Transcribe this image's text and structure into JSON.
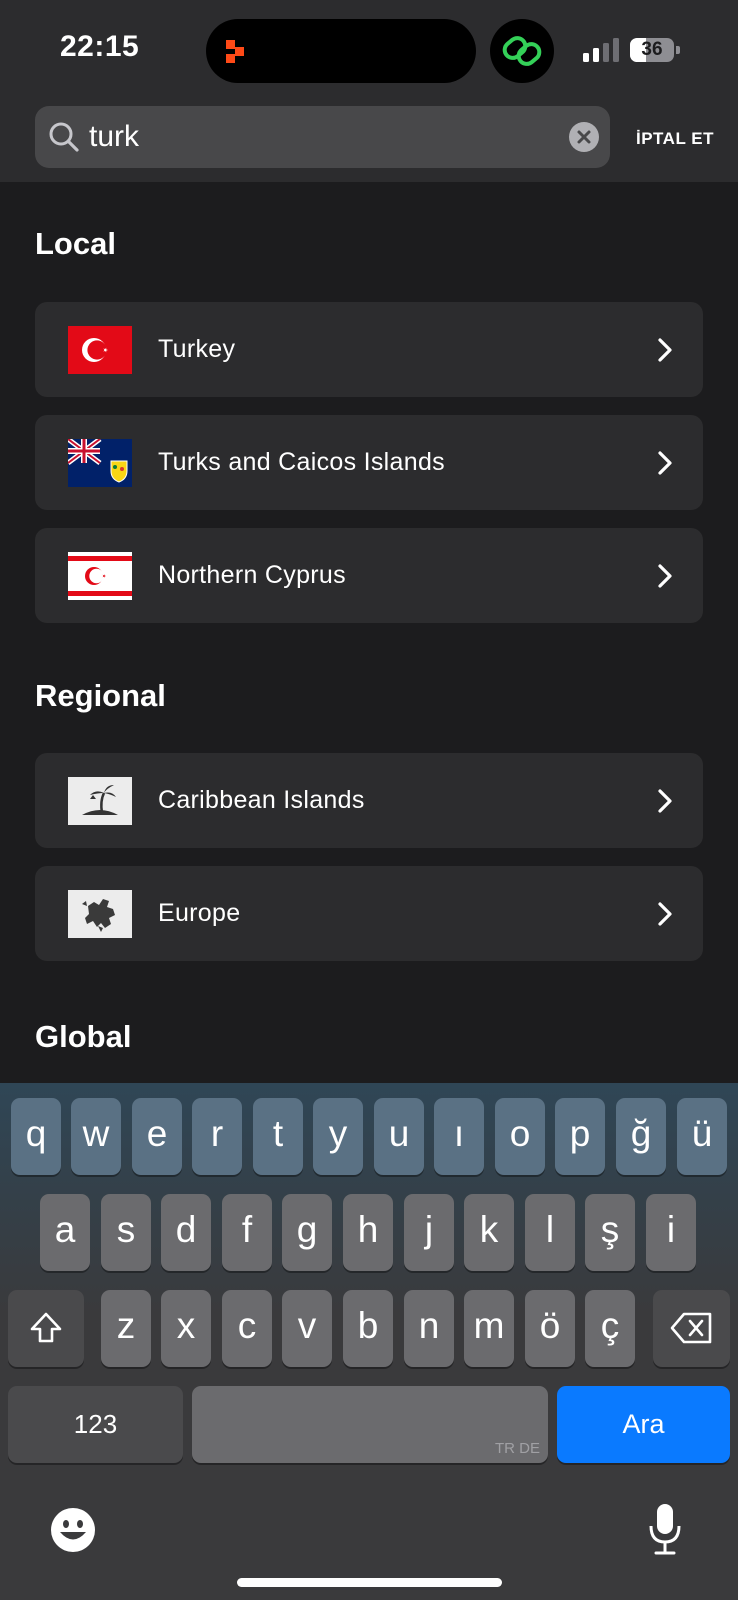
{
  "status": {
    "time": "22:15",
    "battery": "36"
  },
  "search": {
    "value": "turk",
    "cancel_label": "İPTAL ET"
  },
  "sections": {
    "local": "Local",
    "regional": "Regional",
    "global": "Global"
  },
  "local_items": [
    {
      "label": "Turkey",
      "icon": "turkey-flag"
    },
    {
      "label": "Turks and Caicos Islands",
      "icon": "turks-caicos-flag"
    },
    {
      "label": "Northern Cyprus",
      "icon": "northern-cyprus-flag"
    }
  ],
  "regional_items": [
    {
      "label": "Caribbean Islands",
      "icon": "island-icon"
    },
    {
      "label": "Europe",
      "icon": "europe-map-icon"
    }
  ],
  "keyboard": {
    "row1": [
      "q",
      "w",
      "e",
      "r",
      "t",
      "y",
      "u",
      "ı",
      "o",
      "p",
      "ğ",
      "ü"
    ],
    "row2": [
      "a",
      "s",
      "d",
      "f",
      "g",
      "h",
      "j",
      "k",
      "l",
      "ş",
      "i"
    ],
    "row3": [
      "z",
      "x",
      "c",
      "v",
      "b",
      "n",
      "m",
      "ö",
      "ç"
    ],
    "numbers_label": "123",
    "space_hint": "TR DE",
    "return_label": "Ara"
  },
  "colors": {
    "accent": "#0a7aff",
    "row_bg": "#2c2c2e",
    "page_bg": "#1c1c1e"
  }
}
